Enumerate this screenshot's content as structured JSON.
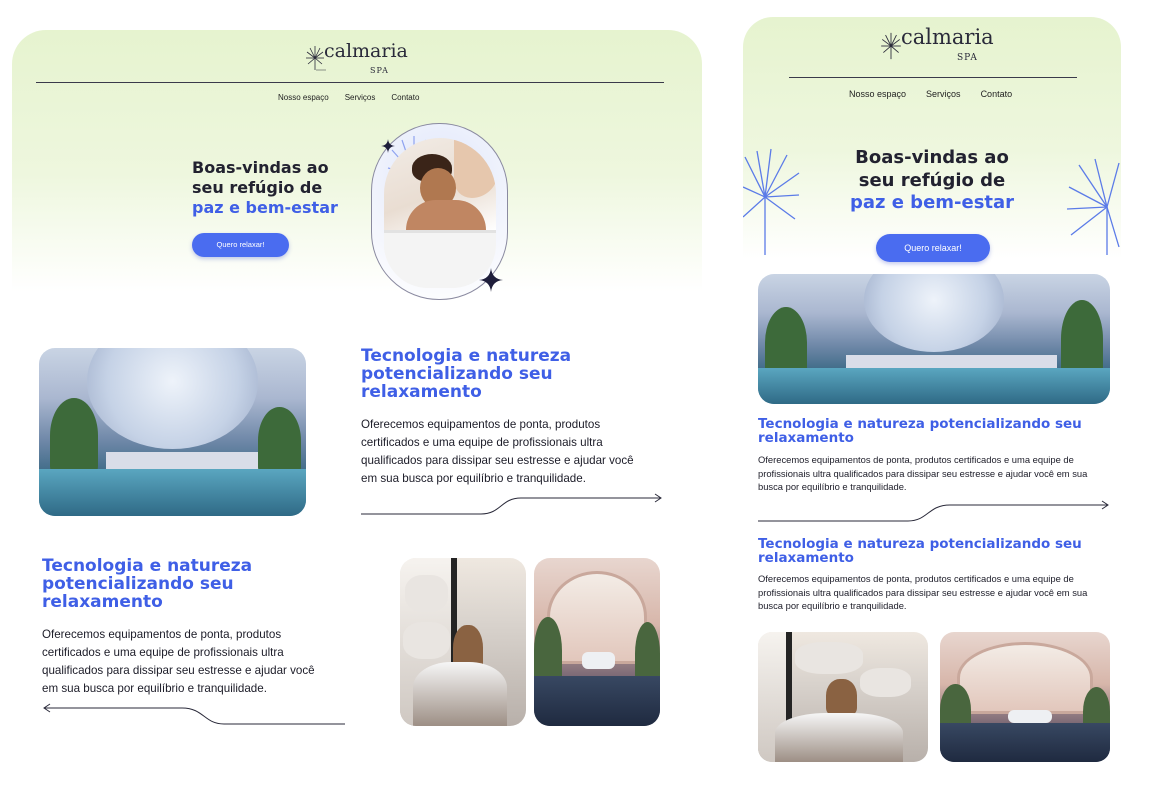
{
  "brand": {
    "name": "calmaria",
    "sub": "SPA"
  },
  "nav": [
    "Nosso espaço",
    "Serviços",
    "Contato"
  ],
  "hero": {
    "line1": "Boas-vindas ao",
    "line2": "seu refúgio de",
    "accent": "paz e bem-estar",
    "cta": "Quero relaxar!"
  },
  "desktop": {
    "section1": {
      "title_l1": "Tecnologia e natureza",
      "title_l2": "potencializando seu",
      "title_l3": "relaxamento",
      "text_l1": "Oferecemos equipamentos de ponta, produtos",
      "text_l2": "certificados e uma equipe de profissionais ultra",
      "text_l3": "qualificados para dissipar seu estresse e ajudar você",
      "text_l4": "em sua busca por equilíbrio e tranquilidade."
    },
    "section2": {
      "title_l1": "Tecnologia e natureza",
      "title_l2": "potencializando seu",
      "title_l3": "relaxamento",
      "text_l1": "Oferecemos equipamentos de ponta, produtos",
      "text_l2": "certificados e uma equipe de profissionais ultra",
      "text_l3": "qualificados para dissipar seu estresse e ajudar você",
      "text_l4": "em sua busca por equilíbrio e tranquilidade."
    }
  },
  "mobile": {
    "section1": {
      "title_l1": "Tecnologia e natureza potencializando seu",
      "title_l2": "relaxamento",
      "text_l1": "Oferecemos equipamentos de ponta, produtos certificados e uma equipe de",
      "text_l2": "profissionais ultra qualificados para dissipar seu estresse e ajudar você em sua",
      "text_l3": "busca por equilíbrio e tranquilidade."
    },
    "section2": {
      "title_l1": "Tecnologia e natureza potencializando seu",
      "title_l2": "relaxamento",
      "text_l1": "Oferecemos equipamentos de ponta, produtos certificados e uma equipe de",
      "text_l2": "profissionais ultra qualificados para dissipar seu estresse e ajudar você em sua",
      "text_l3": "busca por equilíbrio e tranquilidade."
    }
  },
  "colors": {
    "accent": "#3f5fe6",
    "button": "#4a6cf0",
    "hero_bg": "#e6f3cf",
    "text": "#1c1c28"
  },
  "icons": [
    "dandelion-logo-icon",
    "sparkle-star-icon",
    "arrow-curve-icon",
    "dandelion-decoration-icon"
  ]
}
